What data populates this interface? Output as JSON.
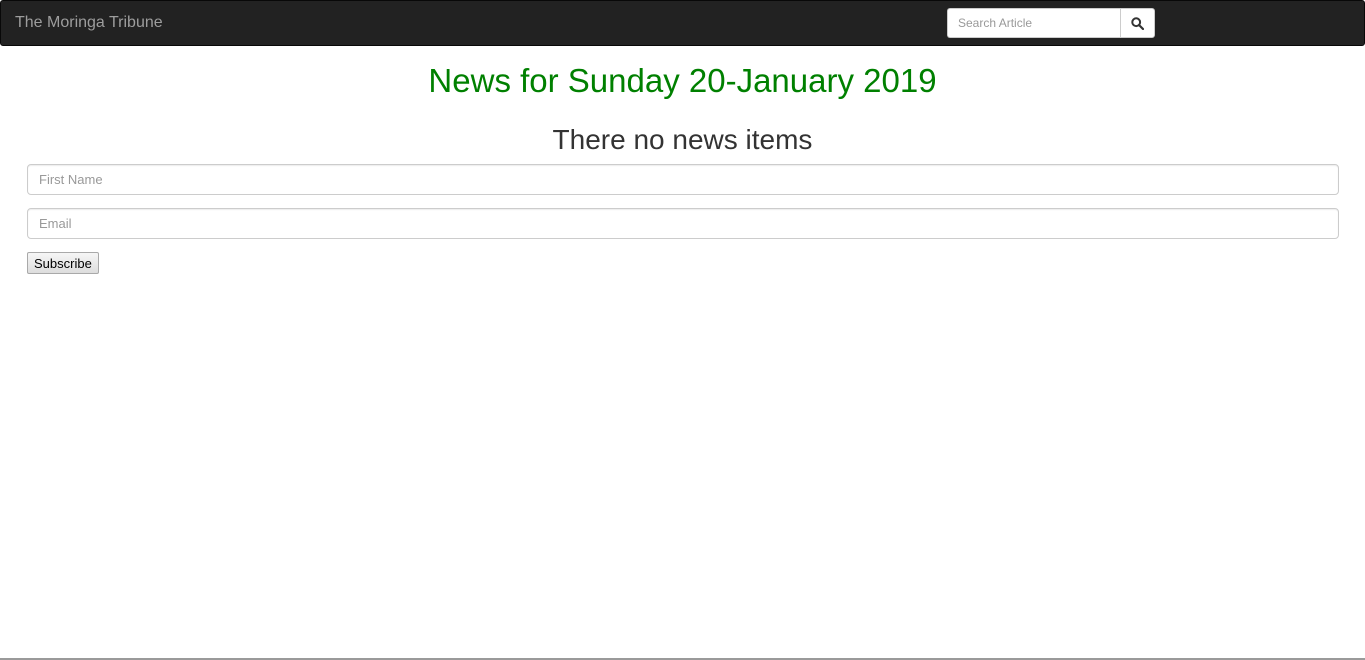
{
  "navbar": {
    "brand": "The Moringa Tribune",
    "search": {
      "placeholder": "Search Article",
      "button_icon": "search-icon"
    }
  },
  "main": {
    "date_heading": "News for Sunday 20-January 2019",
    "empty_message": "There no news items"
  },
  "subscribe_form": {
    "first_name_placeholder": "First Name",
    "email_placeholder": "Email",
    "submit_label": "Subscribe"
  },
  "colors": {
    "navbar_bg": "#222222",
    "brand_text": "#9d9d9d",
    "date_heading": "#008000",
    "body_text": "#333333"
  }
}
